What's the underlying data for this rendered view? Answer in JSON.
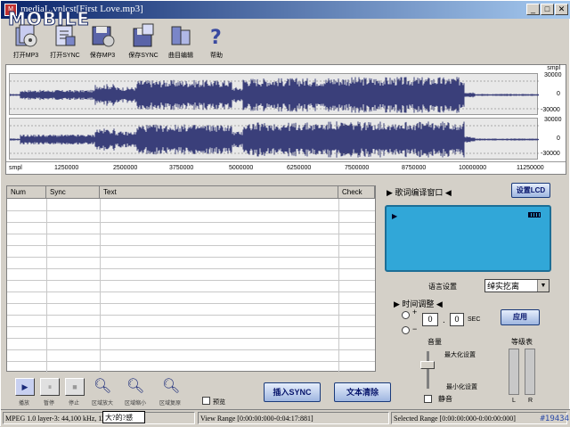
{
  "window": {
    "title": "mediaL.vnlcst[First Love.mp3]",
    "logo": "MOBILE",
    "btn_min": "_",
    "btn_max": "□",
    "btn_close": "✕"
  },
  "toolbar": {
    "open_mp3": "打开MP3",
    "open_sync": "打开SYNC",
    "save_mp3": "保存MP3",
    "save_sync": "保存SYNC",
    "song_edit": "曲目编辑",
    "help": "帮助"
  },
  "waveform": {
    "unit_label": "smpl",
    "scale_top": "30000",
    "scale_zero": "0",
    "scale_bottom": "-30000",
    "ticks": [
      "smpl",
      "1250000",
      "2500000",
      "3750000",
      "5000000",
      "6250000",
      "7500000",
      "8750000",
      "10000000",
      "11250000"
    ]
  },
  "table": {
    "headers": [
      "Num",
      "Sync",
      "Text",
      "Check"
    ]
  },
  "lyric": {
    "window_title": "▶ 歌词编译窗口 ◀",
    "set_lcd": "设置LCD",
    "language_label": "语言设置",
    "language_value": "绰实扢离",
    "time_adjust_title": "▶ 时间调整 ◀",
    "plus": "+",
    "minus": "−",
    "seconds_value": "0",
    "fraction_value": "0",
    "dot": ".",
    "sec_label": "SEC",
    "apply": "应用",
    "volume_label": "音量",
    "max_setting": "最大化设置",
    "min_setting": "最小化设置",
    "mute": "静音",
    "level_label": "等级表",
    "left": "L",
    "right": "R"
  },
  "controls": {
    "play": "播放",
    "pause": "暂停",
    "stop": "停止",
    "zoom_in": "区域放大",
    "zoom_out": "区域缩小",
    "zoom_reset": "区域复原",
    "preview": "预览",
    "insert_sync": "插入SYNC",
    "clear_text": "文本清除"
  },
  "status": {
    "format": "MPEG 1.0 layer-3: 44,100 kHz, 128 Kbps;",
    "overlay": "大?的?感",
    "view_range": "View Range [0:00:00:000-0:04:17:881]",
    "selected_range": "Selected Range [0:00:00:000-0:00:00:000]",
    "badge": "#19434"
  },
  "colors": {
    "titlebar_start": "#0a246a",
    "wave": "#3a3f7a",
    "lcd": "#31a7d8"
  }
}
